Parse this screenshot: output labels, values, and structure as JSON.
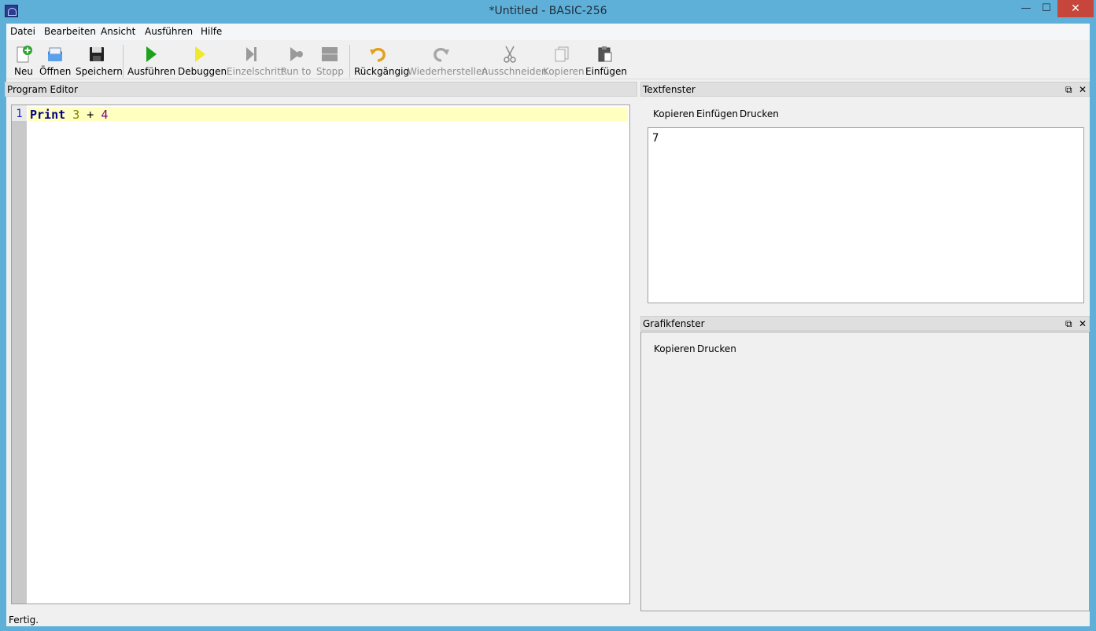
{
  "window": {
    "title": "*Untitled - BASIC-256",
    "minimize": "—",
    "maximize": "☐",
    "close": "✕"
  },
  "menu": [
    "Datei",
    "Bearbeiten",
    "Ansicht",
    "Ausführen",
    "Hilfe"
  ],
  "toolbar": {
    "new": "Neu",
    "open": "Öffnen",
    "save": "Speichern",
    "run": "Ausführen",
    "debug": "Debuggen",
    "step": "Einzelschritt",
    "run_to": "Run to",
    "stop": "Stopp",
    "undo": "Rückgängig",
    "redo": "Wiederherstellen",
    "cut": "Ausschneiden",
    "copy": "Kopieren",
    "paste": "Einfügen"
  },
  "editor": {
    "title": "Program Editor",
    "lines": [
      {
        "number": "1",
        "keyword": "Print",
        "arg1": "3",
        "op": "+",
        "arg2": "4"
      }
    ]
  },
  "text_window": {
    "title": "Textfenster",
    "buttons": [
      "Kopieren",
      "Einfügen",
      "Drucken"
    ],
    "output": "7"
  },
  "graphics_window": {
    "title": "Grafikfenster",
    "buttons": [
      "Kopieren",
      "Drucken"
    ]
  },
  "dock_controls": {
    "float": "⧉",
    "close": "✕"
  },
  "status": "Fertig.",
  "icons": {
    "new": "new-file-icon",
    "open": "open-folder-icon",
    "save": "save-disk-icon",
    "run": "play-icon",
    "debug": "debug-play-icon",
    "step": "step-icon",
    "run_to": "run-to-icon",
    "stop": "stop-icon",
    "undo": "undo-icon",
    "redo": "redo-icon",
    "cut": "scissors-icon",
    "copy": "copy-icon",
    "paste": "paste-icon"
  },
  "colors": {
    "titlebar": "#5fb0d8",
    "close_button": "#c7463c",
    "current_line": "#ffffc0",
    "keyword": "#000080",
    "run_green": "#1ea21e",
    "debug_yellow": "#f2e82a"
  }
}
